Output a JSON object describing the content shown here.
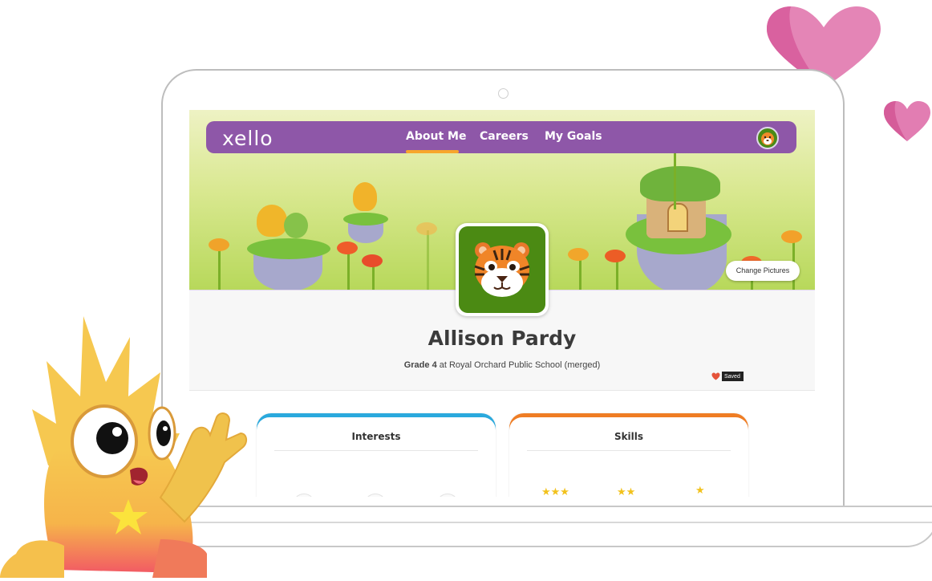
{
  "app": {
    "logo": "xello"
  },
  "nav": {
    "tabs": [
      {
        "label": "About Me",
        "active": true
      },
      {
        "label": "Careers",
        "active": false
      },
      {
        "label": "My Goals",
        "active": false
      }
    ],
    "avatar_icon": "tiger-avatar-icon"
  },
  "banner": {
    "change_pictures_label": "Change Pictures"
  },
  "profile": {
    "name": "Allison Pardy",
    "grade_label": "Grade 4",
    "grade_rest": " at Royal Orchard Public School (merged)",
    "saved_label": "Saved",
    "saved_icon": "heart-icon"
  },
  "cards": [
    {
      "title": "Interests",
      "accent": "#2aa9dd"
    },
    {
      "title": "Skills",
      "accent": "#ef7d24"
    }
  ],
  "colors": {
    "nav": "#8e57a8",
    "tab_underline": "#f7a62c",
    "avatar_bg": "#4b8a13",
    "heart_large": "#e27fb3",
    "mascot": "#f6c850"
  }
}
